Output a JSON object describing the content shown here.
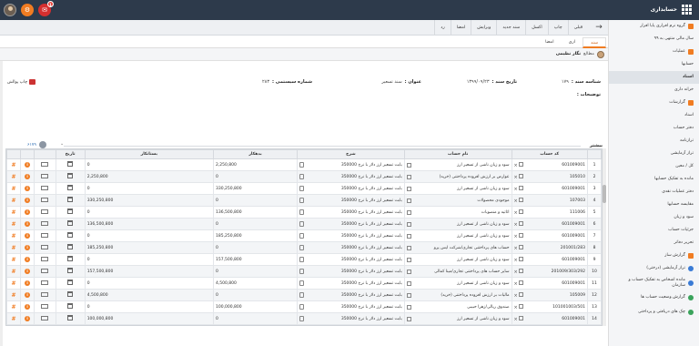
{
  "app": {
    "brand": "حسابداری"
  },
  "topbar": {
    "notif_badge": "1"
  },
  "toolbar": {
    "items": [
      "قبلی",
      "چاپ",
      "اکسل",
      "سند جدید",
      "ویرایش",
      "امضا",
      "رد"
    ]
  },
  "tabs": [
    "سند",
    "اری",
    "امضا"
  ],
  "docbar": {
    "status": "مطالع",
    "user": "نگار نظیمی"
  },
  "form": {
    "doc_no_label": "شناسه سند :",
    "doc_no": "۱۷۹",
    "date_label": "تاریخ سند :",
    "date": "۱۳۹۹/۰۹/۲۳",
    "title_label": "عنوان :",
    "title": "سند تسعیر",
    "sys_no_label": "شماره سیستمی :",
    "sys_no": "۲۸۳",
    "desc_label": "توضیحات :",
    "print_label": "چاپ پوالش",
    "more_label": "بیشتر",
    "attach": "۶۱۷۹"
  },
  "sidebar": {
    "items": [
      {
        "label": "گروه نرم افزاری پایا افزار",
        "icon": "orange"
      },
      {
        "label": "سال مالی منتهی به ۹۹",
        "icon": ""
      },
      {
        "label": "عملیات",
        "icon": "orange"
      },
      {
        "label": "حسابها",
        "icon": ""
      },
      {
        "label": "اسناد",
        "icon": "",
        "active": true
      },
      {
        "label": "خزانه داری",
        "icon": ""
      },
      {
        "label": "گزارشات",
        "icon": "orange"
      },
      {
        "label": "اسناد",
        "icon": ""
      },
      {
        "label": "دفتر حساب",
        "icon": ""
      },
      {
        "label": "ترازنامه",
        "icon": ""
      },
      {
        "label": "تراز آزمایشی",
        "icon": ""
      },
      {
        "label": "کل / معین",
        "icon": ""
      },
      {
        "label": "مانده به تفکیک حسابها",
        "icon": ""
      },
      {
        "label": "دفتر عملیات نقدی",
        "icon": ""
      },
      {
        "label": "مقایسه حسابها",
        "icon": ""
      },
      {
        "label": "سود و زیان",
        "icon": ""
      },
      {
        "label": "جزئیات حساب",
        "icon": ""
      },
      {
        "label": "تحریر دفاتر",
        "icon": ""
      },
      {
        "label": "گزارش ساز",
        "icon": "orange"
      },
      {
        "label": "تراز آزمایشی (درختی)",
        "icon": "blue"
      },
      {
        "label": "مانده اشخاص به تفکیک حساب و سازمان",
        "icon": "blue",
        "multi": true
      },
      {
        "label": "گزارش وضعیت حساب ها",
        "icon": "green"
      },
      {
        "label": "چک های دریافتی و پرداختی",
        "icon": "green",
        "multi": true
      }
    ]
  },
  "grid": {
    "columns": [
      "",
      "کد حساب",
      "نام حساب",
      "شرح",
      "بدهکار",
      "بستانکار",
      "تاریخ",
      "",
      "",
      ""
    ],
    "rows": [
      {
        "n": "1",
        "code": "601009001",
        "name": "سود و زیان ناشی از تسعیر ارز",
        "desc": "بابت تسعیر ارز دلار با نرخ 350000",
        "debit": "2,250,800",
        "credit": "0"
      },
      {
        "n": "2",
        "code": "105010",
        "name": "عوارض بر ارزش افزوده پرداختنی (خرید)",
        "desc": "بابت تسعیر ارز دلار با نرخ 350000",
        "debit": "0",
        "credit": "2,250,800"
      },
      {
        "n": "3",
        "code": "601009001",
        "name": "سود و زیان ناشی از تسعیر ارز",
        "desc": "بابت تسعیر ارز دلار با نرخ 350000",
        "debit": "330,250,800",
        "credit": "0"
      },
      {
        "n": "4",
        "code": "107003",
        "name": "موجودی محصولات",
        "desc": "بابت تسعیر ارز دلار با نرخ 350000",
        "debit": "0",
        "credit": "330,250,800"
      },
      {
        "n": "5",
        "code": "111006",
        "name": "اثاثیه و منصوبات",
        "desc": "بابت تسعیر ارز دلار با نرخ 350000",
        "debit": "136,500,800",
        "credit": "0"
      },
      {
        "n": "6",
        "code": "601009001",
        "name": "سود و زیان ناشی از تسعیر ارز",
        "desc": "بابت تسعیر ارز دلار با نرخ 350000",
        "debit": "0",
        "credit": "136,500,800"
      },
      {
        "n": "7",
        "code": "601009001",
        "name": "سود و زیان ناشی از تسعیر ارز",
        "desc": "بابت تسعیر ارز دلار با نرخ 350000",
        "debit": "185,250,800",
        "credit": "0"
      },
      {
        "n": "8",
        "code": "201001/283",
        "name": "حساب های پرداختنی تجاری/شرکت ایس پرو",
        "desc": "بابت تسعیر ارز دلار با نرخ 350000",
        "debit": "0",
        "credit": "185,250,800"
      },
      {
        "n": "9",
        "code": "601009001",
        "name": "سود و زیان ناشی از تسعیر ارز",
        "desc": "بابت تسعیر ارز دلار با نرخ 350000",
        "debit": "157,500,800",
        "credit": "0"
      },
      {
        "n": "10",
        "code": "201009/303/292",
        "name": "سایر حساب های پرداختنی تجاری/مینا کمالی",
        "desc": "بابت تسعیر ارز دلار با نرخ 350000",
        "debit": "0",
        "credit": "157,500,800"
      },
      {
        "n": "11",
        "code": "601009001",
        "name": "سود و زیان ناشی از تسعیر ارز",
        "desc": "بابت تسعیر ارز دلار با نرخ 350000",
        "debit": "4,500,800",
        "credit": "0"
      },
      {
        "n": "12",
        "code": "105009",
        "name": "مالیات بر ارزش افزوده پرداختنی (خرید)",
        "desc": "بابت تسعیر ارز دلار با نرخ 350000",
        "debit": "0",
        "credit": "4,500,800"
      },
      {
        "n": "13",
        "code": "101001003/501",
        "name": "صندوق ریالی/زهرا حبیبی",
        "desc": "بابت تسعیر ارز دلار با نرخ 350000",
        "debit": "100,000,800",
        "credit": "0"
      },
      {
        "n": "14",
        "code": "601009001",
        "name": "سود و زیان ناشی از تسعیر ارز",
        "desc": "بابت تسعیر ارز دلار با نرخ 350000",
        "debit": "0",
        "credit": "100,000,800"
      }
    ]
  }
}
